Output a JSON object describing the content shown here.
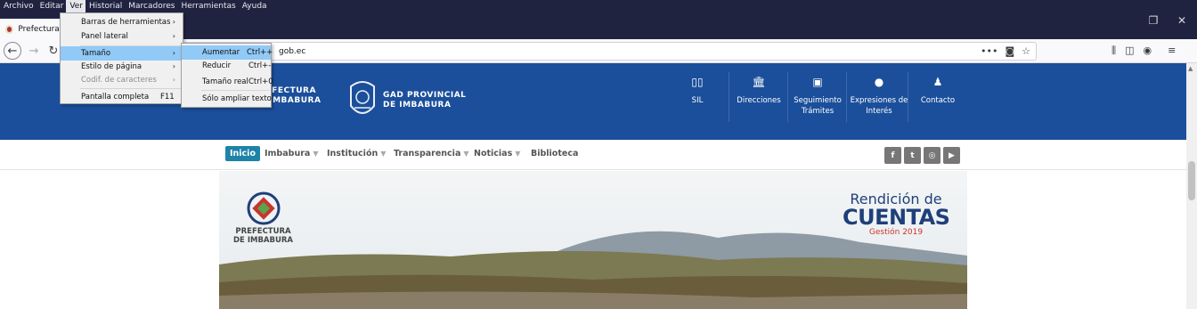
{
  "menubar": {
    "items": [
      {
        "label": "Archivo"
      },
      {
        "label": "Editar"
      },
      {
        "label": "Ver"
      },
      {
        "label": "Historial"
      },
      {
        "label": "Marcadores"
      },
      {
        "label": "Herramientas"
      },
      {
        "label": "Ayuda"
      }
    ]
  },
  "tab": {
    "title": "Prefectura d"
  },
  "url": {
    "text": "gob.ec"
  },
  "ver_menu": {
    "items": [
      {
        "label": "Barras de herramientas",
        "shortcut": ""
      },
      {
        "label": "Panel lateral",
        "shortcut": ""
      },
      {
        "label": "Tamaño",
        "shortcut": ""
      },
      {
        "label": "Estilo de página",
        "shortcut": ""
      },
      {
        "label": "Codif. de caracteres",
        "shortcut": ""
      },
      {
        "label": "Pantalla completa",
        "shortcut": "F11"
      }
    ]
  },
  "tamano_menu": {
    "items": [
      {
        "label": "Aumentar",
        "shortcut": "Ctrl++"
      },
      {
        "label": "Reducir",
        "shortcut": "Ctrl+-"
      },
      {
        "label": "Tamaño real",
        "shortcut": "Ctrl+0"
      },
      {
        "label": "Sólo ampliar texto",
        "shortcut": ""
      }
    ]
  },
  "site": {
    "brand1": {
      "line1": "PREFECTURA",
      "line2": "DE IMBABURA"
    },
    "brand2": {
      "line1": "GAD PROVINCIAL",
      "line2": "DE IMBABURA"
    },
    "header_nav": [
      {
        "label": "SIL",
        "icon": "map-icon"
      },
      {
        "label": "Direcciones",
        "icon": "bank-icon"
      },
      {
        "label": "Seguimiento Trámites",
        "icon": "id-card-icon"
      },
      {
        "label": "Expresiones de Interés",
        "icon": "comment-icon"
      },
      {
        "label": "Contacto",
        "icon": "user-icon"
      }
    ],
    "sub_nav": [
      {
        "label": "Inicio"
      },
      {
        "label": "Imbabura"
      },
      {
        "label": "Institución"
      },
      {
        "label": "Transparencia"
      },
      {
        "label": "Noticias"
      },
      {
        "label": "Biblioteca"
      }
    ],
    "social": [
      "f",
      "t",
      "ig",
      "yt"
    ],
    "banner": {
      "logo_line1": "PREFECTURA",
      "logo_line2": "DE IMBABURA",
      "title_line1": "Rendición de",
      "title_line2": "CUENTAS",
      "title_line3": "Gestión 2019"
    }
  },
  "colors": {
    "menubar_bg": "#202340",
    "header_band": "#1b4f9b",
    "active_tab": "#1e83a8",
    "menu_highlight": "#91c9f7"
  }
}
